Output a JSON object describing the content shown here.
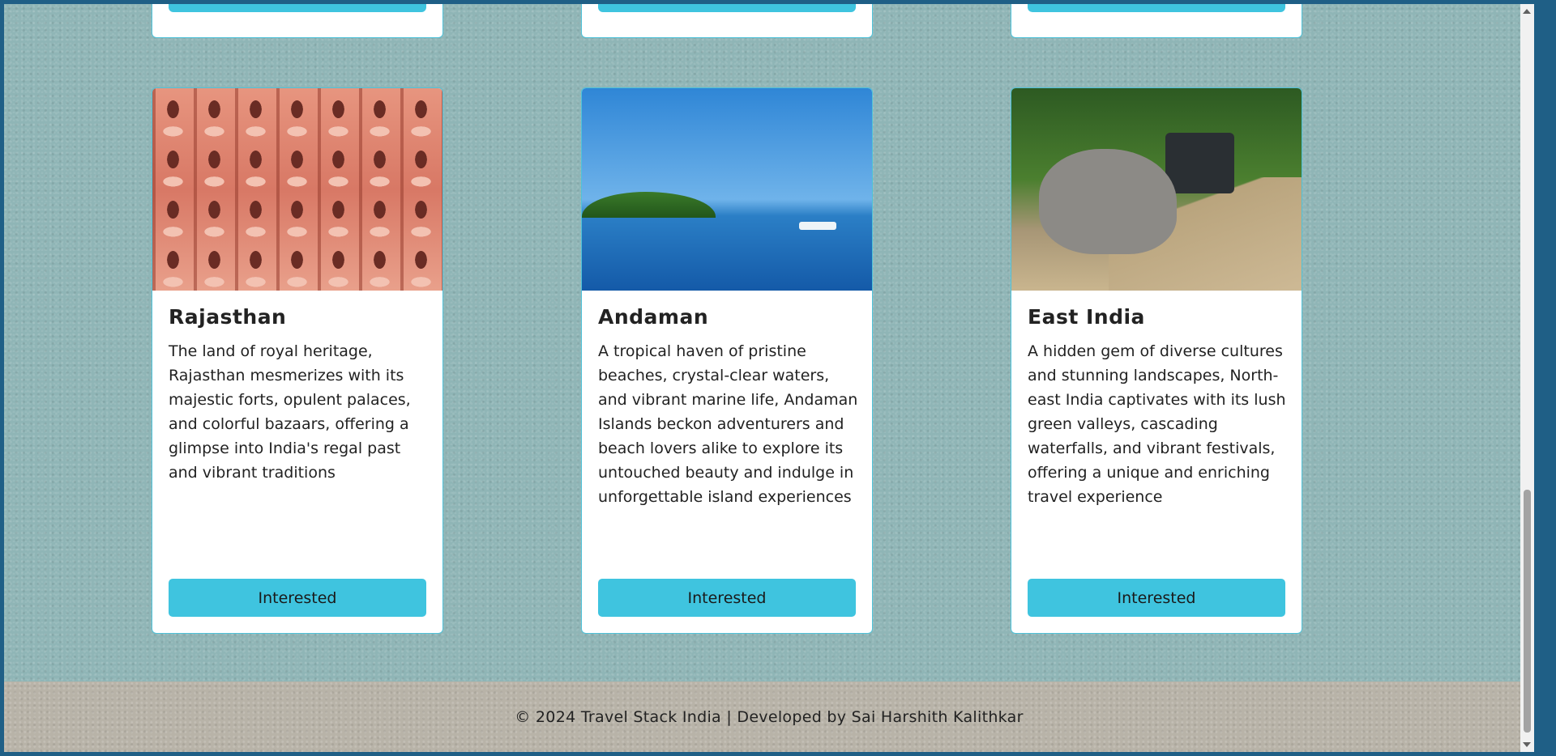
{
  "cards": [
    {
      "title": "Rajasthan",
      "description": "The land of royal heritage, Rajasthan mesmerizes with its majestic forts, opulent palaces, and colorful bazaars, offering a glimpse into India's regal past and vibrant traditions",
      "button": "Interested",
      "image_icon": "palace-facade-image"
    },
    {
      "title": "Andaman",
      "description": "A tropical haven of pristine beaches, crystal-clear waters, and vibrant marine life, Andaman Islands beckon adventurers and beach lovers alike to explore its untouched beauty and indulge in unforgettable island experiences",
      "button": "Interested",
      "image_icon": "sea-island-image"
    },
    {
      "title": "East India",
      "description": "A hidden gem of diverse cultures and stunning landscapes, North-east India captivates with its lush green valleys, cascading waterfalls, and vibrant festivals, offering a unique and enriching travel experience",
      "button": "Interested",
      "image_icon": "rhino-safari-image"
    }
  ],
  "footer": {
    "text": "© 2024 Travel Stack India | Developed by Sai Harshith Kalithkar"
  },
  "colors": {
    "accent": "#3fc4df",
    "page_background": "#8fb5b6",
    "footer_background": "#b8b3a8"
  }
}
